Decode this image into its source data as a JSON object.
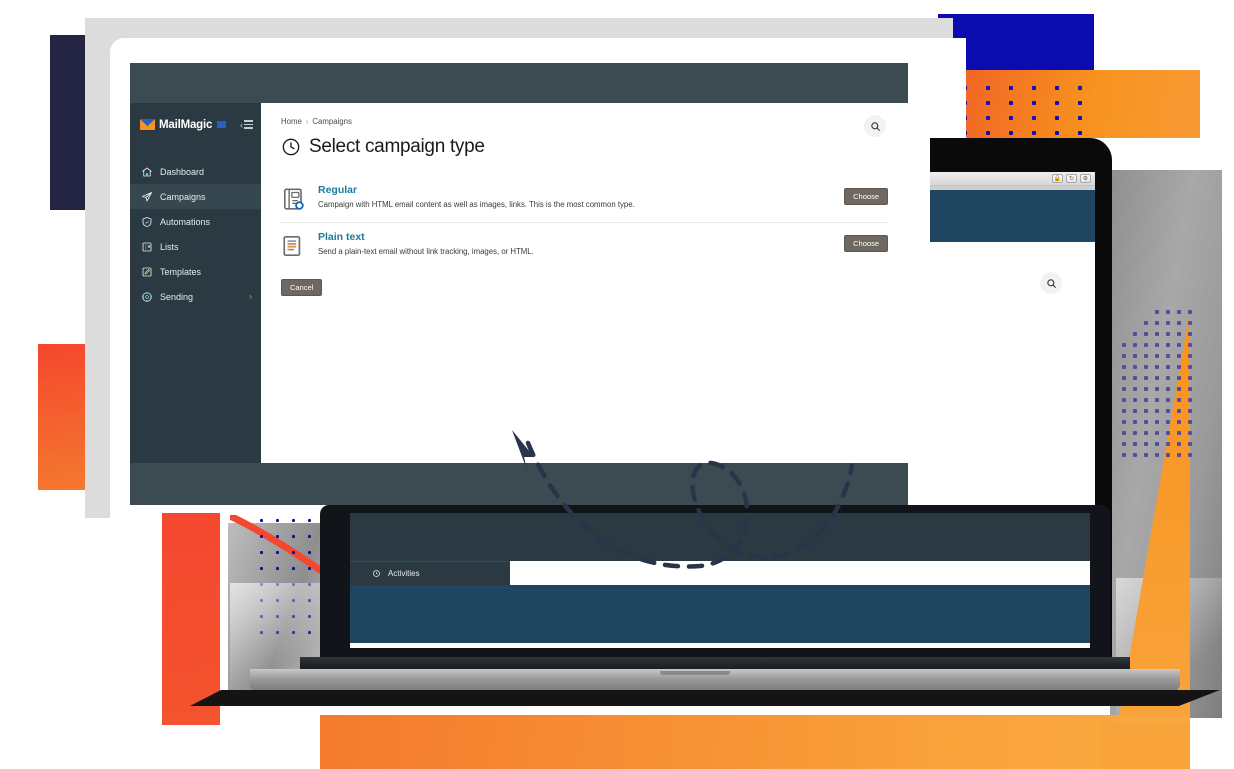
{
  "brand": {
    "name": "MailMagic",
    "logo_icon": "envelope-icon",
    "accent_orange": "#f7931e",
    "accent_blue": "#2a5dbd",
    "link_color": "#1b7b9e",
    "sidebar_bg": "#2a3942",
    "topbar_bg": "#3c4a52"
  },
  "sidebar": {
    "collapse_label": "‹",
    "collapse_icon": "hamburger-icon",
    "items": [
      {
        "label": "Dashboard",
        "icon": "home-icon",
        "active": false,
        "chevron": ""
      },
      {
        "label": "Campaigns",
        "icon": "paper-plane-icon",
        "active": true,
        "chevron": ""
      },
      {
        "label": "Automations",
        "icon": "shield-check-icon",
        "active": false,
        "chevron": ""
      },
      {
        "label": "Lists",
        "icon": "list-grid-icon",
        "active": false,
        "chevron": ""
      },
      {
        "label": "Templates",
        "icon": "pencil-square-icon",
        "active": false,
        "chevron": ""
      },
      {
        "label": "Sending",
        "icon": "gear-icon",
        "active": false,
        "chevron": "›"
      }
    ],
    "footer": {
      "label": "Activities",
      "icon": "clock-history-icon",
      "external_icon": "external-link-icon"
    }
  },
  "header": {
    "breadcrumb": [
      "Home",
      "Campaigns"
    ],
    "breadcrumb_separator": "›",
    "title": "Select campaign type",
    "title_icon": "clock-icon",
    "search_icon": "search-icon"
  },
  "campaign_types": [
    {
      "icon": "html-document-icon",
      "title": "Regular",
      "description": "Campaign with HTML email content as well as images, links. This is the most common type.",
      "button": "Choose"
    },
    {
      "icon": "plain-text-document-icon",
      "title": "Plain text",
      "description": "Send a plain-text email without link tracking, images, or HTML.",
      "button": "Choose"
    }
  ],
  "actions": {
    "cancel": "Cancel"
  },
  "device_right": {
    "toolbar_buttons": [
      "lock-icon",
      "refresh-icon",
      "gear-icon"
    ],
    "search_icon": "search-icon",
    "header_color": "#1f4560"
  },
  "device_laptop": {
    "footer": {
      "label": "Activities",
      "icon": "clock-history-icon",
      "external_icon": "external-link-icon"
    },
    "header_color": "#2a3942",
    "panel_color": "#1f4560"
  },
  "decor": {
    "navy": "#242444",
    "blue": "#0b0bb0",
    "orange": "#f7931e",
    "red": "#f4472f",
    "gray_frame": "#dcdcdc",
    "dot_navy": "#242444",
    "dot_purple": "#5a4a9a",
    "cursor_color": "#28344a",
    "arrow_color": "#28344a"
  }
}
